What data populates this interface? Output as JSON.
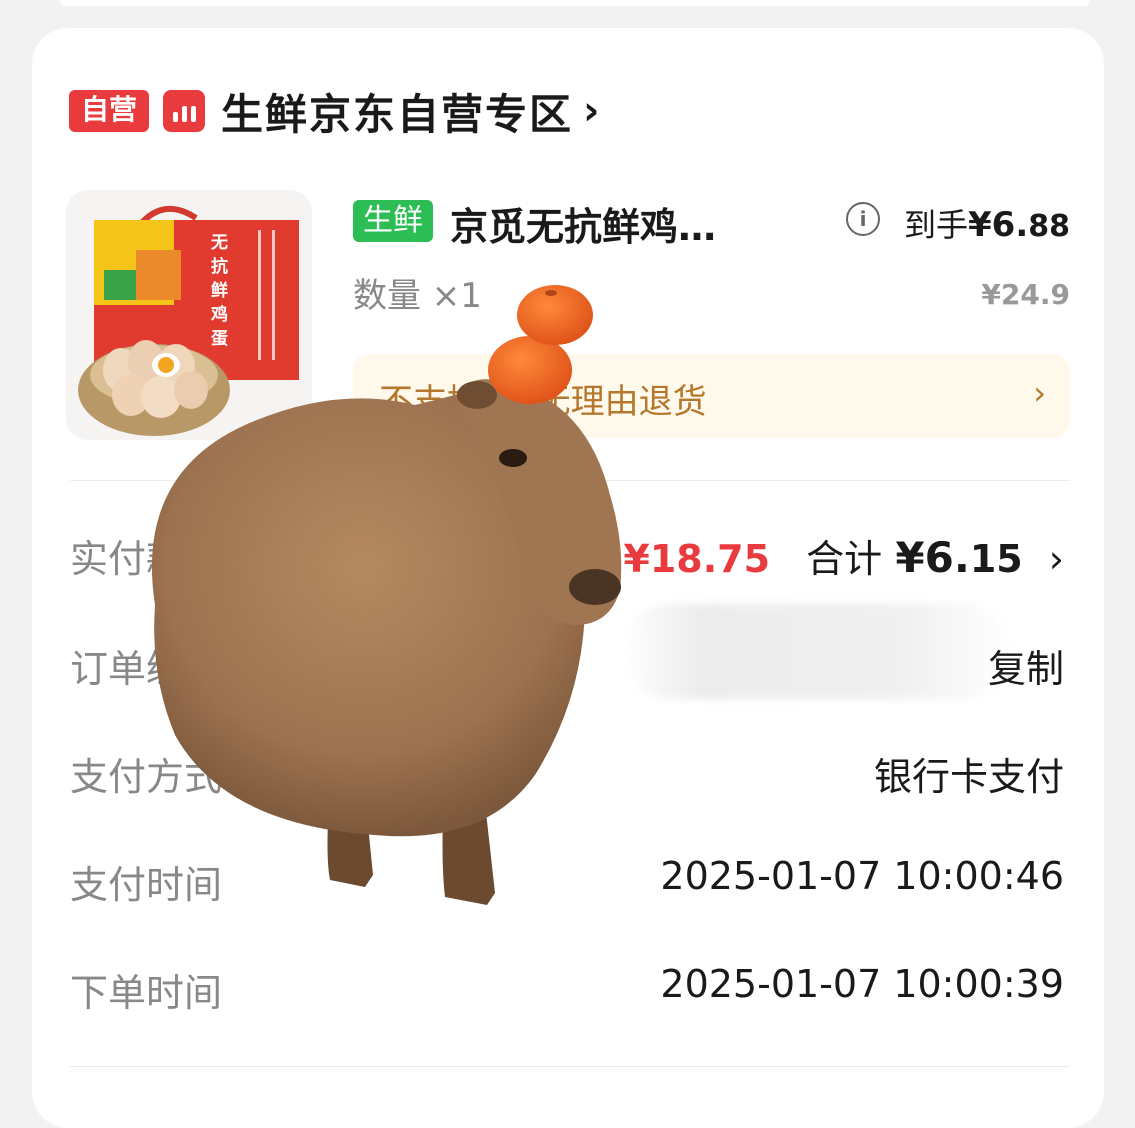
{
  "store": {
    "badge": "自营",
    "name": "生鲜京东自营专区",
    "chevron": "›"
  },
  "product": {
    "tag": "生鲜",
    "title": "京觅无抗鲜鸡…",
    "final_label": "到手",
    "final_price_main": "¥6.",
    "final_price_cents": "88",
    "qty_label": "数量 ×1",
    "original_price": "¥24.9",
    "package_text": "无抗鲜鸡蛋"
  },
  "return_policy": {
    "text": "不支持7天无理由退货",
    "arrow": "›"
  },
  "rows": {
    "paid_label": "实付款",
    "discount": "共减 ¥18.75",
    "total_label": "合计",
    "total_main": "¥6.",
    "total_cents": "15",
    "total_chevron": "›",
    "order_label": "订单编号",
    "copy_label": "复制",
    "pay_method_label": "支付方式",
    "pay_method_value": "银行卡支付",
    "pay_time_label": "支付时间",
    "pay_time_value": "2025-01-07 10:00:46",
    "order_time_label": "下单时间",
    "order_time_value": "2025-01-07 10:00:39"
  },
  "colors": {
    "accent_red": "#e93b3d",
    "fresh_green": "#2dbd55",
    "return_text": "#b5772b"
  },
  "icons": [
    "store-logo-icon",
    "info-icon",
    "chevron-right-icon"
  ]
}
